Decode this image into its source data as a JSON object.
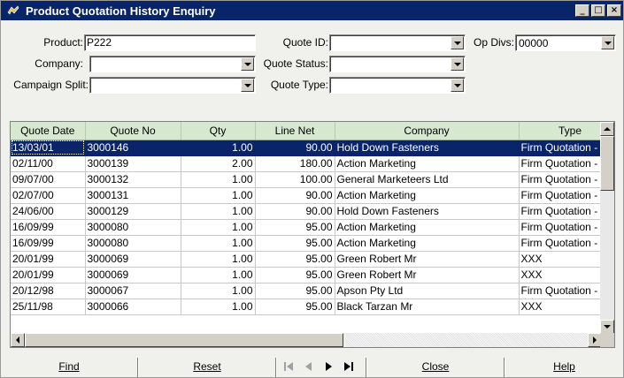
{
  "window": {
    "title": "Product Quotation History Enquiry",
    "controls": [
      "minimize",
      "maximize",
      "close"
    ]
  },
  "form": {
    "product_label": "Product:",
    "product_value": "P222",
    "company_label": "Company:",
    "company_value": "",
    "campaign_split_label": "Campaign Split:",
    "campaign_split_value": "",
    "quote_id_label": "Quote ID:",
    "quote_id_value": "",
    "quote_status_label": "Quote Status:",
    "quote_status_value": "",
    "quote_type_label": "Quote Type:",
    "quote_type_value": "",
    "op_divs_label": "Op Divs:",
    "op_divs_value": "00000"
  },
  "grid": {
    "columns": [
      "Quote Date",
      "Quote No",
      "Qty",
      "Line Net",
      "Company",
      "Type"
    ],
    "rows": [
      [
        "13/03/01",
        "3000146",
        "1.00",
        "90.00",
        "Hold Down Fasteners",
        "Firm Quotation - Fax"
      ],
      [
        "02/11/00",
        "3000139",
        "2.00",
        "180.00",
        "Action Marketing",
        "Firm Quotation - Fax"
      ],
      [
        "09/07/00",
        "3000132",
        "1.00",
        "100.00",
        "General Marketeers Ltd",
        "Firm Quotation - Fax"
      ],
      [
        "02/07/00",
        "3000131",
        "1.00",
        "90.00",
        "Action Marketing",
        "Firm Quotation - Fax"
      ],
      [
        "24/06/00",
        "3000129",
        "1.00",
        "90.00",
        "Hold Down Fasteners",
        "Firm Quotation - Fax"
      ],
      [
        "16/09/99",
        "3000080",
        "1.00",
        "95.00",
        "Action Marketing",
        "Firm Quotation - Fax"
      ],
      [
        "16/09/99",
        "3000080",
        "1.00",
        "95.00",
        "Action Marketing",
        "Firm Quotation - Fax"
      ],
      [
        "20/01/99",
        "3000069",
        "1.00",
        "95.00",
        "Green Robert Mr",
        "XXX"
      ],
      [
        "20/01/99",
        "3000069",
        "1.00",
        "95.00",
        "Green Robert Mr",
        "XXX"
      ],
      [
        "20/12/98",
        "3000067",
        "1.00",
        "95.00",
        "Apson Pty Ltd",
        "Firm Quotation - Fax"
      ],
      [
        "25/11/98",
        "3000066",
        "1.00",
        "95.00",
        "Black Tarzan Mr",
        "XXX"
      ]
    ],
    "selected_row": 0
  },
  "buttons": {
    "find": "Find",
    "reset": "Reset",
    "close": "Close",
    "help": "Help",
    "nav": [
      "first-icon",
      "prev-icon",
      "next-icon",
      "last-icon"
    ]
  },
  "colors": {
    "titlebar": "#08246b",
    "selection": "#0a246a",
    "header": "#d6e8d0"
  }
}
